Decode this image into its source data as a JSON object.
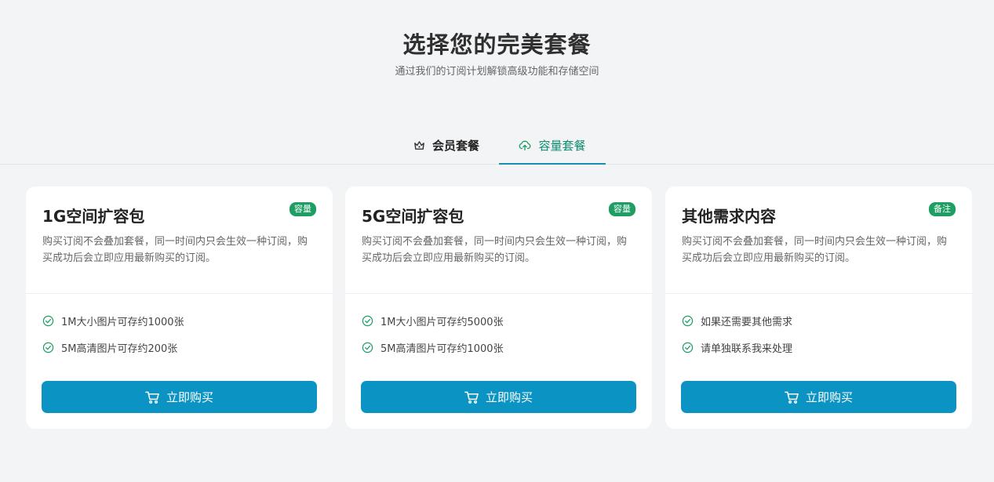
{
  "header": {
    "title": "选择您的完美套餐",
    "subtitle": "通过我们的订阅计划解锁高级功能和存储空间"
  },
  "tabs": [
    {
      "label": "会员套餐",
      "icon": "crown-icon",
      "active": false
    },
    {
      "label": "容量套餐",
      "icon": "cloud-upload-icon",
      "active": true
    }
  ],
  "colors": {
    "accent": "#0b94c3",
    "active_tab_text": "#0f8b6e",
    "badge": "#1e9e62",
    "check": "#1e9e62"
  },
  "cards": [
    {
      "title": "1G空间扩容包",
      "badge": "容量",
      "description": "购买订阅不会叠加套餐，同一时间内只会生效一种订阅，购买成功后会立即应用最新购买的订阅。",
      "features": [
        "1M大小图片可存约1000张",
        "5M高清图片可存约200张"
      ],
      "button": "立即购买"
    },
    {
      "title": "5G空间扩容包",
      "badge": "容量",
      "description": "购买订阅不会叠加套餐，同一时间内只会生效一种订阅，购买成功后会立即应用最新购买的订阅。",
      "features": [
        "1M大小图片可存约5000张",
        "5M高清图片可存约1000张"
      ],
      "button": "立即购买"
    },
    {
      "title": "其他需求内容",
      "badge": "备注",
      "description": "购买订阅不会叠加套餐，同一时间内只会生效一种订阅，购买成功后会立即应用最新购买的订阅。",
      "features": [
        "如果还需要其他需求",
        "请单独联系我来处理"
      ],
      "button": "立即购买"
    }
  ]
}
